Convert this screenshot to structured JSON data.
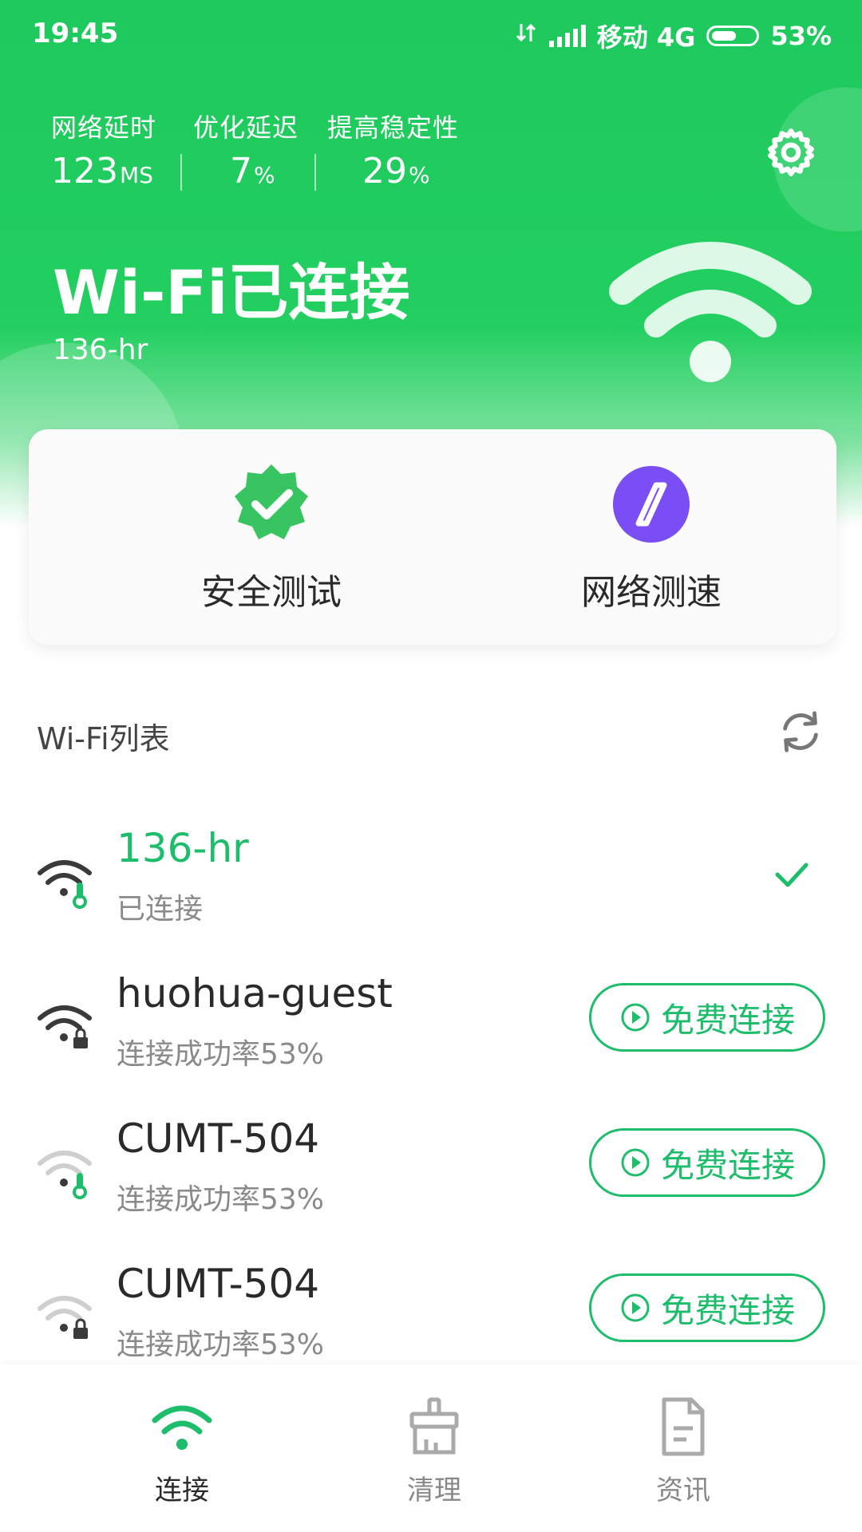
{
  "status_bar": {
    "time": "19:45",
    "carrier": "移动 4G",
    "battery": "53%"
  },
  "header": {
    "stats": [
      {
        "label": "网络延时",
        "value": "123",
        "unit": "MS"
      },
      {
        "label": "优化延迟",
        "value": "7",
        "unit": "%"
      },
      {
        "label": "提高稳定性",
        "value": "29",
        "unit": "%"
      }
    ],
    "title": "Wi-Fi已连接",
    "ssid": "136-hr"
  },
  "quick_actions": [
    {
      "label": "安全测试",
      "icon": "shield-check-icon"
    },
    {
      "label": "网络测速",
      "icon": "speed-compass-icon"
    }
  ],
  "wifi_list": {
    "title": "Wi-Fi列表",
    "connect_label": "免费连接",
    "items": [
      {
        "name": "136-hr",
        "status": "已连接",
        "connected": true
      },
      {
        "name": "huohua-guest",
        "status": "连接成功率53%",
        "connected": false
      },
      {
        "name": "CUMT-504",
        "status": "连接成功率53%",
        "connected": false
      },
      {
        "name": "CUMT-504",
        "status": "连接成功率53%",
        "connected": false
      }
    ]
  },
  "bottom_nav": [
    {
      "label": "连接",
      "active": true
    },
    {
      "label": "清理",
      "active": false
    },
    {
      "label": "资讯",
      "active": false
    }
  ],
  "colors": {
    "brand_green": "#22cf60",
    "accent_green": "#1ebd6b",
    "speed_purple": "#7a4df5"
  }
}
